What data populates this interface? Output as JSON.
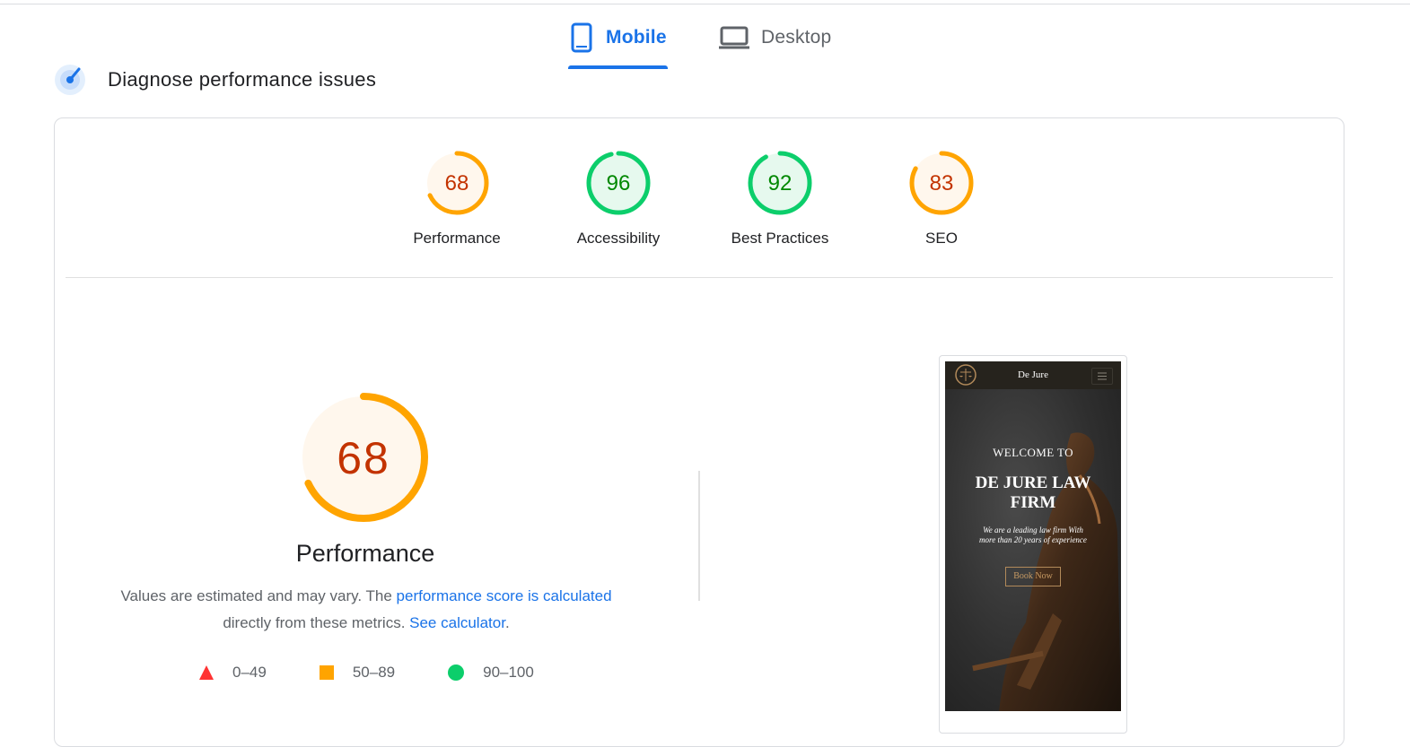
{
  "tabs": [
    {
      "label": "Mobile",
      "icon": "smartphone-icon",
      "active": true
    },
    {
      "label": "Desktop",
      "icon": "laptop-icon",
      "active": false
    }
  ],
  "section": {
    "title": "Diagnose performance issues",
    "icon": "gauge-icon"
  },
  "scores": [
    {
      "label": "Performance",
      "value": "68",
      "score": 68,
      "status": "average"
    },
    {
      "label": "Accessibility",
      "value": "96",
      "score": 96,
      "status": "pass"
    },
    {
      "label": "Best Practices",
      "value": "92",
      "score": 92,
      "status": "pass"
    },
    {
      "label": "SEO",
      "value": "83",
      "score": 83,
      "status": "average"
    }
  ],
  "main": {
    "score": "68",
    "score_fraction": 0.68,
    "title": "Performance",
    "desc_text1": "Values are estimated and may vary. The ",
    "desc_link1": "performance score is calculated",
    "desc_text2": "directly from these metrics. ",
    "desc_link2": "See calculator",
    "desc_text3": "."
  },
  "legend": [
    {
      "range": "0–49",
      "shape": "triangle",
      "color": "#ff3333"
    },
    {
      "range": "50–89",
      "shape": "square",
      "color": "#ffa400"
    },
    {
      "range": "90–100",
      "shape": "circle",
      "color": "#0cce6b"
    }
  ],
  "colors": {
    "average_stroke": "#ffa400",
    "average_text": "#c33300",
    "average_fill": "#fff7ed",
    "pass_stroke": "#0cce6b",
    "pass_text": "#008800",
    "pass_fill": "#e6f9ee",
    "accent": "#1a73e8"
  },
  "screenshot": {
    "brand": "De Jure",
    "welcome": "WELCOME TO",
    "title": "DE JURE LAW FIRM",
    "subtitle": "We are a leading law firm With more than 20 years of experience",
    "button": "Book Now"
  }
}
